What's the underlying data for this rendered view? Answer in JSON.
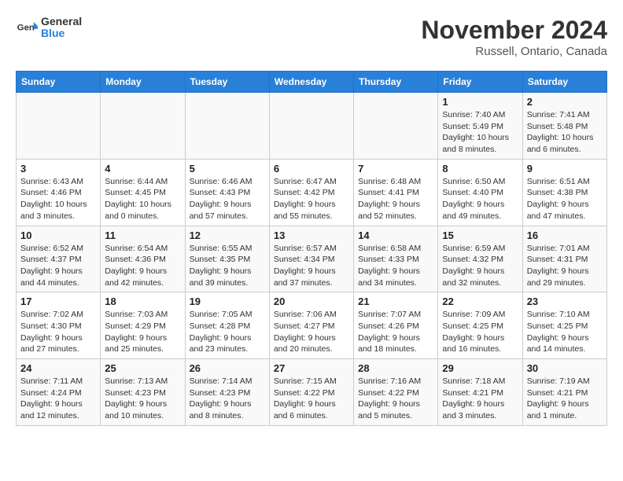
{
  "header": {
    "logo_general": "General",
    "logo_blue": "Blue",
    "month_title": "November 2024",
    "location": "Russell, Ontario, Canada"
  },
  "weekdays": [
    "Sunday",
    "Monday",
    "Tuesday",
    "Wednesday",
    "Thursday",
    "Friday",
    "Saturday"
  ],
  "weeks": [
    [
      {
        "day": "",
        "info": ""
      },
      {
        "day": "",
        "info": ""
      },
      {
        "day": "",
        "info": ""
      },
      {
        "day": "",
        "info": ""
      },
      {
        "day": "",
        "info": ""
      },
      {
        "day": "1",
        "info": "Sunrise: 7:40 AM\nSunset: 5:49 PM\nDaylight: 10 hours and 8 minutes."
      },
      {
        "day": "2",
        "info": "Sunrise: 7:41 AM\nSunset: 5:48 PM\nDaylight: 10 hours and 6 minutes."
      }
    ],
    [
      {
        "day": "3",
        "info": "Sunrise: 6:43 AM\nSunset: 4:46 PM\nDaylight: 10 hours and 3 minutes."
      },
      {
        "day": "4",
        "info": "Sunrise: 6:44 AM\nSunset: 4:45 PM\nDaylight: 10 hours and 0 minutes."
      },
      {
        "day": "5",
        "info": "Sunrise: 6:46 AM\nSunset: 4:43 PM\nDaylight: 9 hours and 57 minutes."
      },
      {
        "day": "6",
        "info": "Sunrise: 6:47 AM\nSunset: 4:42 PM\nDaylight: 9 hours and 55 minutes."
      },
      {
        "day": "7",
        "info": "Sunrise: 6:48 AM\nSunset: 4:41 PM\nDaylight: 9 hours and 52 minutes."
      },
      {
        "day": "8",
        "info": "Sunrise: 6:50 AM\nSunset: 4:40 PM\nDaylight: 9 hours and 49 minutes."
      },
      {
        "day": "9",
        "info": "Sunrise: 6:51 AM\nSunset: 4:38 PM\nDaylight: 9 hours and 47 minutes."
      }
    ],
    [
      {
        "day": "10",
        "info": "Sunrise: 6:52 AM\nSunset: 4:37 PM\nDaylight: 9 hours and 44 minutes."
      },
      {
        "day": "11",
        "info": "Sunrise: 6:54 AM\nSunset: 4:36 PM\nDaylight: 9 hours and 42 minutes."
      },
      {
        "day": "12",
        "info": "Sunrise: 6:55 AM\nSunset: 4:35 PM\nDaylight: 9 hours and 39 minutes."
      },
      {
        "day": "13",
        "info": "Sunrise: 6:57 AM\nSunset: 4:34 PM\nDaylight: 9 hours and 37 minutes."
      },
      {
        "day": "14",
        "info": "Sunrise: 6:58 AM\nSunset: 4:33 PM\nDaylight: 9 hours and 34 minutes."
      },
      {
        "day": "15",
        "info": "Sunrise: 6:59 AM\nSunset: 4:32 PM\nDaylight: 9 hours and 32 minutes."
      },
      {
        "day": "16",
        "info": "Sunrise: 7:01 AM\nSunset: 4:31 PM\nDaylight: 9 hours and 29 minutes."
      }
    ],
    [
      {
        "day": "17",
        "info": "Sunrise: 7:02 AM\nSunset: 4:30 PM\nDaylight: 9 hours and 27 minutes."
      },
      {
        "day": "18",
        "info": "Sunrise: 7:03 AM\nSunset: 4:29 PM\nDaylight: 9 hours and 25 minutes."
      },
      {
        "day": "19",
        "info": "Sunrise: 7:05 AM\nSunset: 4:28 PM\nDaylight: 9 hours and 23 minutes."
      },
      {
        "day": "20",
        "info": "Sunrise: 7:06 AM\nSunset: 4:27 PM\nDaylight: 9 hours and 20 minutes."
      },
      {
        "day": "21",
        "info": "Sunrise: 7:07 AM\nSunset: 4:26 PM\nDaylight: 9 hours and 18 minutes."
      },
      {
        "day": "22",
        "info": "Sunrise: 7:09 AM\nSunset: 4:25 PM\nDaylight: 9 hours and 16 minutes."
      },
      {
        "day": "23",
        "info": "Sunrise: 7:10 AM\nSunset: 4:25 PM\nDaylight: 9 hours and 14 minutes."
      }
    ],
    [
      {
        "day": "24",
        "info": "Sunrise: 7:11 AM\nSunset: 4:24 PM\nDaylight: 9 hours and 12 minutes."
      },
      {
        "day": "25",
        "info": "Sunrise: 7:13 AM\nSunset: 4:23 PM\nDaylight: 9 hours and 10 minutes."
      },
      {
        "day": "26",
        "info": "Sunrise: 7:14 AM\nSunset: 4:23 PM\nDaylight: 9 hours and 8 minutes."
      },
      {
        "day": "27",
        "info": "Sunrise: 7:15 AM\nSunset: 4:22 PM\nDaylight: 9 hours and 6 minutes."
      },
      {
        "day": "28",
        "info": "Sunrise: 7:16 AM\nSunset: 4:22 PM\nDaylight: 9 hours and 5 minutes."
      },
      {
        "day": "29",
        "info": "Sunrise: 7:18 AM\nSunset: 4:21 PM\nDaylight: 9 hours and 3 minutes."
      },
      {
        "day": "30",
        "info": "Sunrise: 7:19 AM\nSunset: 4:21 PM\nDaylight: 9 hours and 1 minute."
      }
    ]
  ],
  "colors": {
    "header_bg": "#2980d9",
    "odd_row": "#f9f9f9",
    "even_row": "#ffffff"
  }
}
